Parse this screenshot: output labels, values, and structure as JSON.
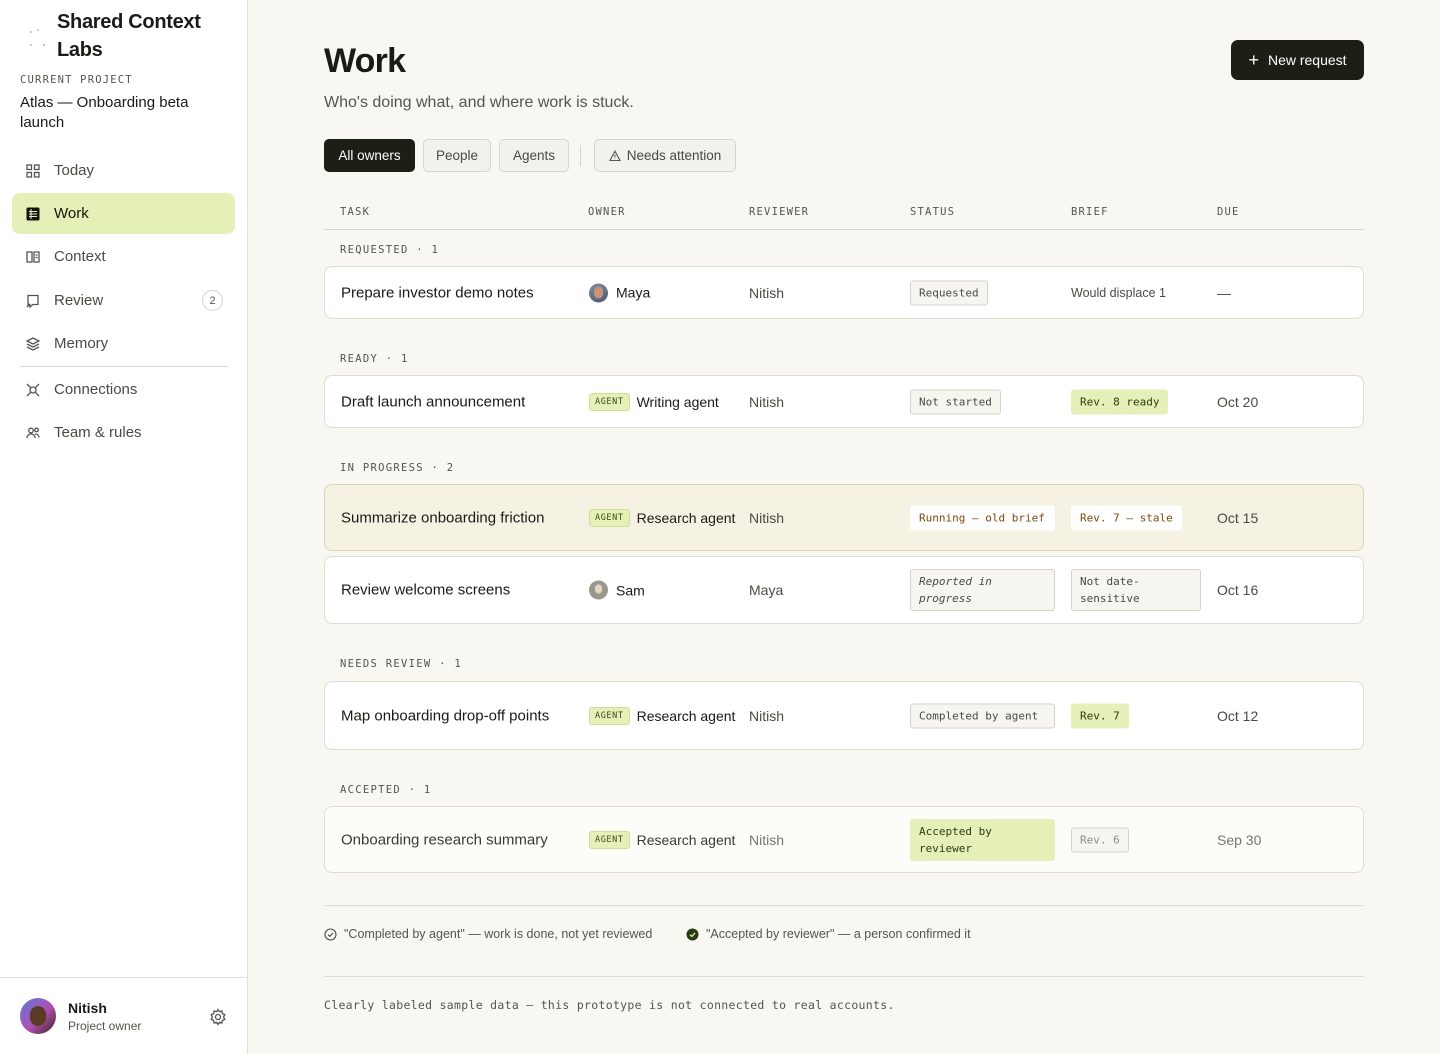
{
  "org": {
    "name": "Shared Context Labs"
  },
  "project": {
    "label": "CURRENT PROJECT",
    "name": "Atlas — Onboarding beta launch"
  },
  "nav": [
    {
      "label": "Today",
      "icon": "grid-icon"
    },
    {
      "label": "Work",
      "icon": "table-icon",
      "active": true
    },
    {
      "label": "Context",
      "icon": "book-icon"
    },
    {
      "label": "Review",
      "icon": "review-icon",
      "badge": "2"
    },
    {
      "label": "Memory",
      "icon": "layers-icon"
    },
    {
      "label": "Connections",
      "icon": "plug-icon"
    },
    {
      "label": "Team & rules",
      "icon": "team-icon"
    }
  ],
  "user": {
    "name": "Nitish",
    "role": "Project owner"
  },
  "page": {
    "title": "Work",
    "subtitle": "Who's doing what, and where work is stuck.",
    "new_request": "New request"
  },
  "filters": [
    "All owners",
    "People",
    "Agents",
    "Needs attention"
  ],
  "columns": [
    "TASK",
    "OWNER",
    "REVIEWER",
    "STATUS",
    "BRIEF",
    "DUE"
  ],
  "agent_tag": "AGENT",
  "groups": [
    {
      "label": "REQUESTED · 1",
      "rows": [
        {
          "task": "Prepare investor demo notes",
          "owner": "Maya",
          "owner_type": "person",
          "reviewer": "Nitish",
          "status": "Requested",
          "brief": "Would displace 1",
          "due": "—"
        }
      ]
    },
    {
      "label": "READY · 1",
      "rows": [
        {
          "task": "Draft launch announcement",
          "owner": "Writing agent",
          "owner_type": "agent",
          "reviewer": "Nitish",
          "status": "Not started",
          "brief": "Rev. 8 ready",
          "due": "Oct 20"
        }
      ]
    },
    {
      "label": "IN PROGRESS · 2",
      "rows": [
        {
          "task": "Summarize onboarding friction",
          "owner": "Research agent",
          "owner_type": "agent",
          "reviewer": "Nitish",
          "status": "Running — old brief",
          "brief": "Rev. 7 — stale",
          "due": "Oct 15"
        },
        {
          "task": "Review welcome screens",
          "owner": "Sam",
          "owner_type": "person",
          "reviewer": "Maya",
          "status": "Reported in progress",
          "brief": "Not date-sensitive",
          "due": "Oct 16"
        }
      ]
    },
    {
      "label": "NEEDS REVIEW · 1",
      "rows": [
        {
          "task": "Map onboarding drop-off points",
          "owner": "Research agent",
          "owner_type": "agent",
          "reviewer": "Nitish",
          "status": "Completed by agent",
          "brief": "Rev. 7",
          "due": "Oct 12"
        }
      ]
    },
    {
      "label": "ACCEPTED · 1",
      "rows": [
        {
          "task": "Onboarding research summary",
          "owner": "Research agent",
          "owner_type": "agent",
          "reviewer": "Nitish",
          "status": "Accepted by reviewer",
          "brief": "Rev. 6",
          "due": "Sep 30"
        }
      ]
    }
  ],
  "legend": [
    "\"Completed by agent\" — work is done, not yet reviewed",
    "\"Accepted by reviewer\" — a person confirmed it"
  ],
  "footer_note": "Clearly labeled sample data — this prototype is not connected to real accounts.",
  "colors": {
    "accent": "#e4f0b8",
    "primary": "#1d1f17",
    "stale": "#7a4a10",
    "highlight_row": "#f6f2e3"
  }
}
